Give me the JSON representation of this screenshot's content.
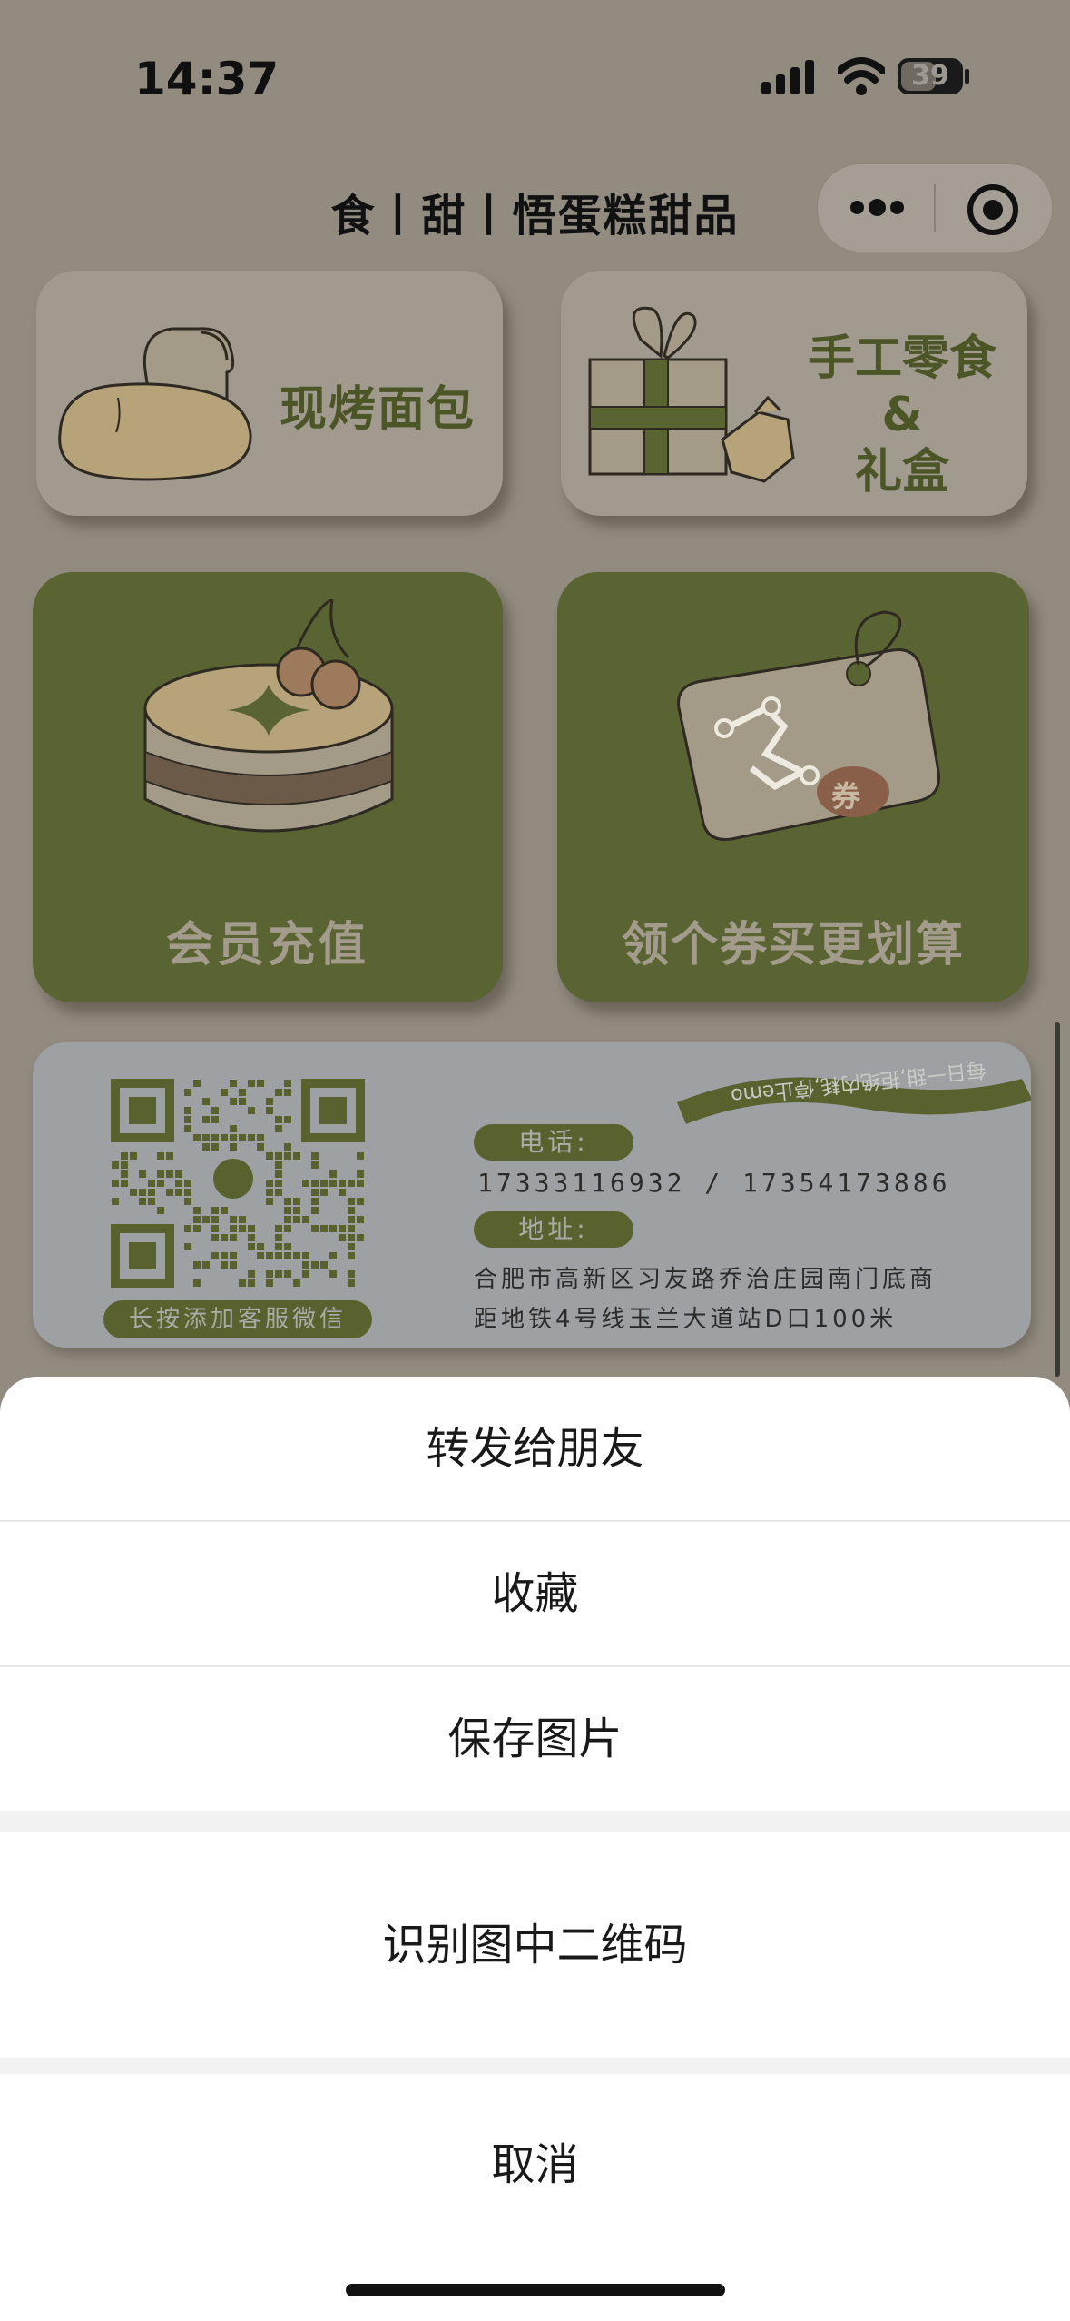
{
  "status_bar": {
    "time": "14:37",
    "battery": "39",
    "icons": [
      "signal-icon",
      "wifi-icon",
      "battery-icon"
    ]
  },
  "nav": {
    "title": "食丨甜丨悟蛋糕甜品",
    "capsule_icons": [
      "more-icon",
      "close-miniprogram-icon"
    ]
  },
  "menu": [
    {
      "label": "现烤面包",
      "icon": "bread-icon"
    },
    {
      "label_lines": [
        "手工零食",
        "&",
        "礼盒"
      ],
      "icon": "gift-box-icon"
    },
    {
      "label": "会员充值",
      "icon": "cake-icon"
    },
    {
      "label": "领个券买更划算",
      "icon": "coupon-tag-icon",
      "badge": "券"
    }
  ],
  "contact": {
    "qr_caption": "长按添加客服微信",
    "ribbon_text": "每日一甜,拒绝内耗,停止emo",
    "phone_label": "电话:",
    "phone": "17333116932 / 17354173886",
    "address_label": "地址:",
    "address_line1": "合肥市高新区习友路乔治庄园南门底商",
    "address_line2": "距地铁4号线玉兰大道站D口100米"
  },
  "action_sheet": {
    "items": [
      "转发给朋友",
      "收藏",
      "保存图片"
    ],
    "scan_qr": "识别图中二维码",
    "cancel": "取消"
  },
  "colors": {
    "overlay_bg": "#928c80",
    "card_green": "#5a6332",
    "sheet_bg": "#ffffff"
  }
}
